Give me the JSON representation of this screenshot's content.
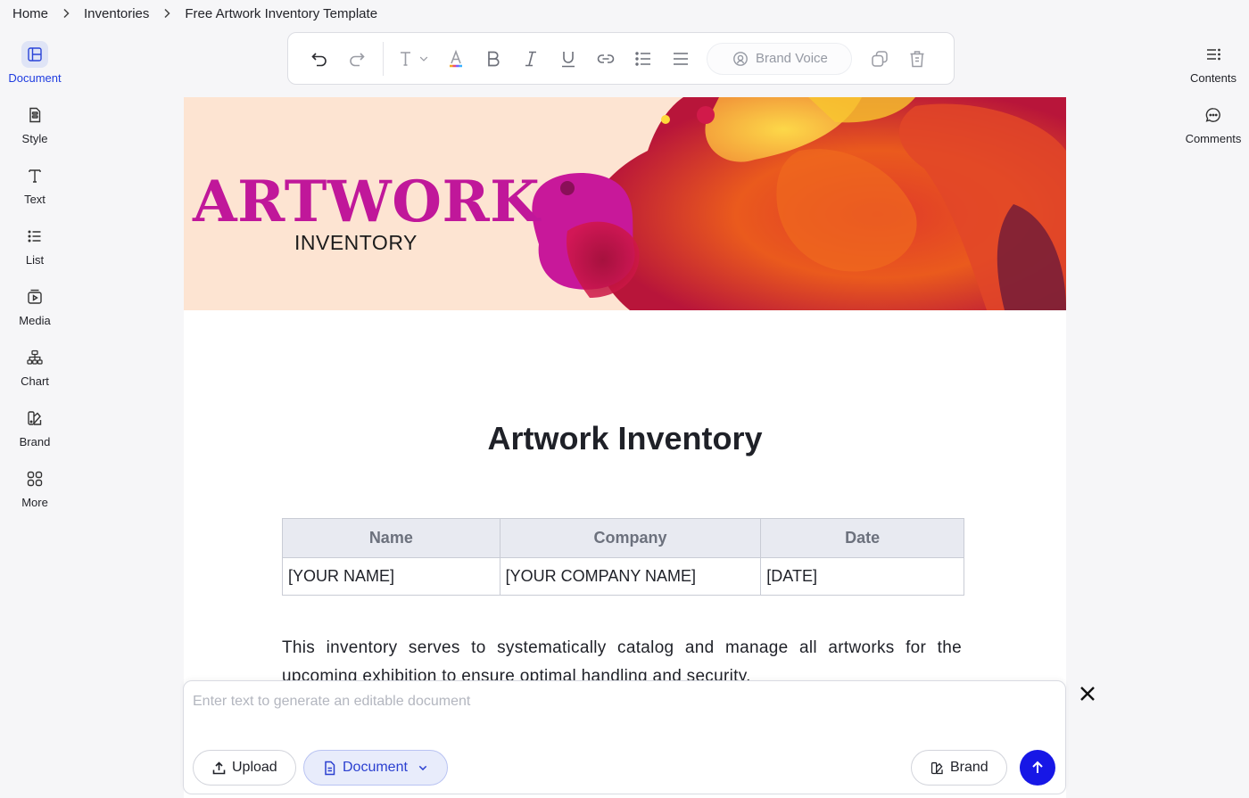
{
  "breadcrumb": [
    "Home",
    "Inventories",
    "Free Artwork Inventory Template"
  ],
  "left_rail": [
    {
      "label": "Document",
      "icon": "layout-icon",
      "active": true
    },
    {
      "label": "Style",
      "icon": "style-icon"
    },
    {
      "label": "Text",
      "icon": "text-icon"
    },
    {
      "label": "List",
      "icon": "list-icon"
    },
    {
      "label": "Media",
      "icon": "media-icon"
    },
    {
      "label": "Chart",
      "icon": "chart-icon"
    },
    {
      "label": "Brand",
      "icon": "brand-icon"
    },
    {
      "label": "More",
      "icon": "grid-icon"
    }
  ],
  "right_rail": [
    {
      "label": "Contents",
      "icon": "contents-icon"
    },
    {
      "label": "Comments",
      "icon": "comment-icon"
    }
  ],
  "toolbar": {
    "brand_voice_label": "Brand Voice"
  },
  "document": {
    "hero_title": "ARTWORK",
    "hero_subtitle": "INVENTORY",
    "title": "Artwork Inventory",
    "table": {
      "headers": [
        "Name",
        "Company",
        "Date"
      ],
      "row": [
        "[YOUR NAME]",
        "[YOUR COMPANY NAME]",
        "[DATE]"
      ]
    },
    "intro": "This inventory serves to systematically catalog and manage all artworks for the upcoming exhibition to ensure optimal handling and security."
  },
  "prompt": {
    "placeholder": "Enter text to generate an editable document",
    "upload_label": "Upload",
    "document_label": "Document",
    "brand_label": "Brand"
  },
  "colors": {
    "accent": "#1f3ce0",
    "send": "#1717e6",
    "hero_bg": "#fde4d2",
    "hero_title": "#c0179a"
  }
}
